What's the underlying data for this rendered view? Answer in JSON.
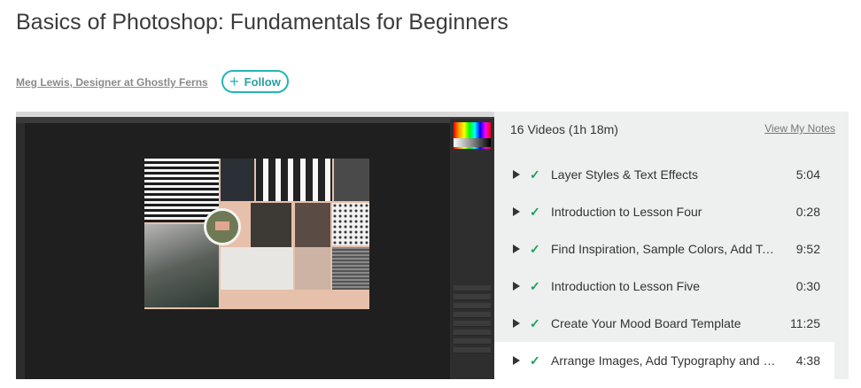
{
  "course": {
    "title": "Basics of Photoshop: Fundamentals for Beginners",
    "author": "Meg Lewis, Designer at Ghostly Ferns",
    "follow_label": "Follow"
  },
  "playlist": {
    "count_label": "16 Videos (1h 18m)",
    "notes_link": "View My Notes",
    "videos": [
      {
        "title": "Layer Styles & Text Effects",
        "duration": "5:04",
        "completed": true
      },
      {
        "title": "Introduction to Lesson Four",
        "duration": "0:28",
        "completed": true
      },
      {
        "title": "Find Inspiration, Sample Colors, Add Texture",
        "duration": "9:52",
        "completed": true
      },
      {
        "title": "Introduction to Lesson Five",
        "duration": "0:30",
        "completed": true
      },
      {
        "title": "Create Your Mood Board Template",
        "duration": "11:25",
        "completed": true
      },
      {
        "title": "Arrange Images, Add Typography and Finalize",
        "duration": "4:38",
        "completed": true,
        "active": true
      }
    ]
  },
  "colors": {
    "accent": "#24b5b5",
    "check": "#19a05a",
    "sidebar_bg": "#edf0ef"
  }
}
